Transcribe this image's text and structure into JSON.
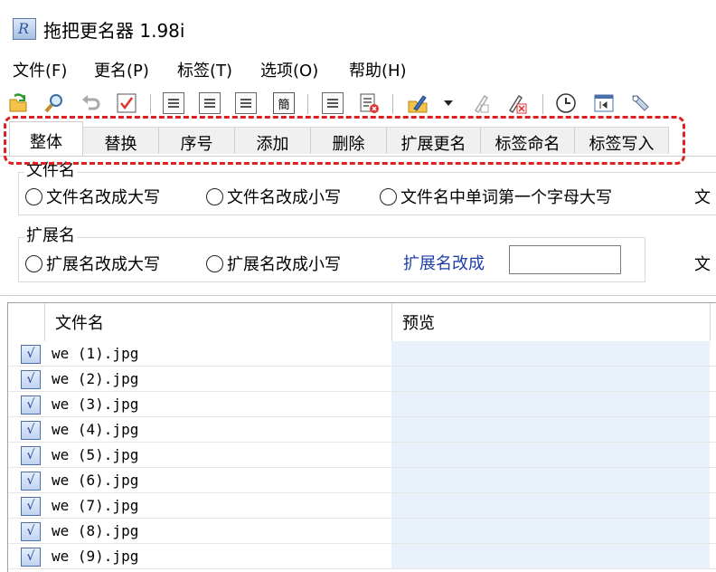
{
  "window": {
    "title": "拖把更名器 1.98i",
    "app_icon_letter": "R"
  },
  "menu": [
    "文件(F)",
    "更名(P)",
    "标签(T)",
    "选项(O)",
    "帮助(H)"
  ],
  "toolbar": {
    "icons": [
      "refresh-open-icon",
      "search-icon",
      "undo-icon",
      "check-icon",
      "list-icon-1",
      "list-icon-2",
      "list-icon-3",
      "simplified-icon",
      "document-icon",
      "document-delete-icon",
      "edit-pen-icon",
      "dropdown-arrow-icon",
      "pen-disabled-icon",
      "pen-delete-icon",
      "clock-icon",
      "window-icon",
      "tool-icon"
    ],
    "simplified_glyph": "簡"
  },
  "tabs": [
    "整体",
    "替换",
    "序号",
    "添加",
    "删除",
    "扩展更名",
    "标签命名",
    "标签写入"
  ],
  "active_tab": "整体",
  "highlight_color": "#e02020",
  "filename_group": {
    "legend": "文件名",
    "options": [
      "文件名改成大写",
      "文件名改成小写",
      "文件名中单词第一个字母大写"
    ],
    "cut_text": "文"
  },
  "ext_group": {
    "legend": "扩展名",
    "options": [
      "扩展名改成大写",
      "扩展名改成小写"
    ],
    "change_label": "扩展名改成",
    "input_value": "",
    "cut_text": "文"
  },
  "grid": {
    "headers": [
      "文件名",
      "预览"
    ],
    "rows": [
      {
        "checked": "√",
        "name": "we (1).jpg",
        "preview": ""
      },
      {
        "checked": "√",
        "name": "we (2).jpg",
        "preview": ""
      },
      {
        "checked": "√",
        "name": "we (3).jpg",
        "preview": ""
      },
      {
        "checked": "√",
        "name": "we (4).jpg",
        "preview": ""
      },
      {
        "checked": "√",
        "name": "we (5).jpg",
        "preview": ""
      },
      {
        "checked": "√",
        "name": "we (6).jpg",
        "preview": ""
      },
      {
        "checked": "√",
        "name": "we (7).jpg",
        "preview": ""
      },
      {
        "checked": "√",
        "name": "we (8).jpg",
        "preview": ""
      },
      {
        "checked": "√",
        "name": "we (9).jpg",
        "preview": ""
      }
    ]
  }
}
